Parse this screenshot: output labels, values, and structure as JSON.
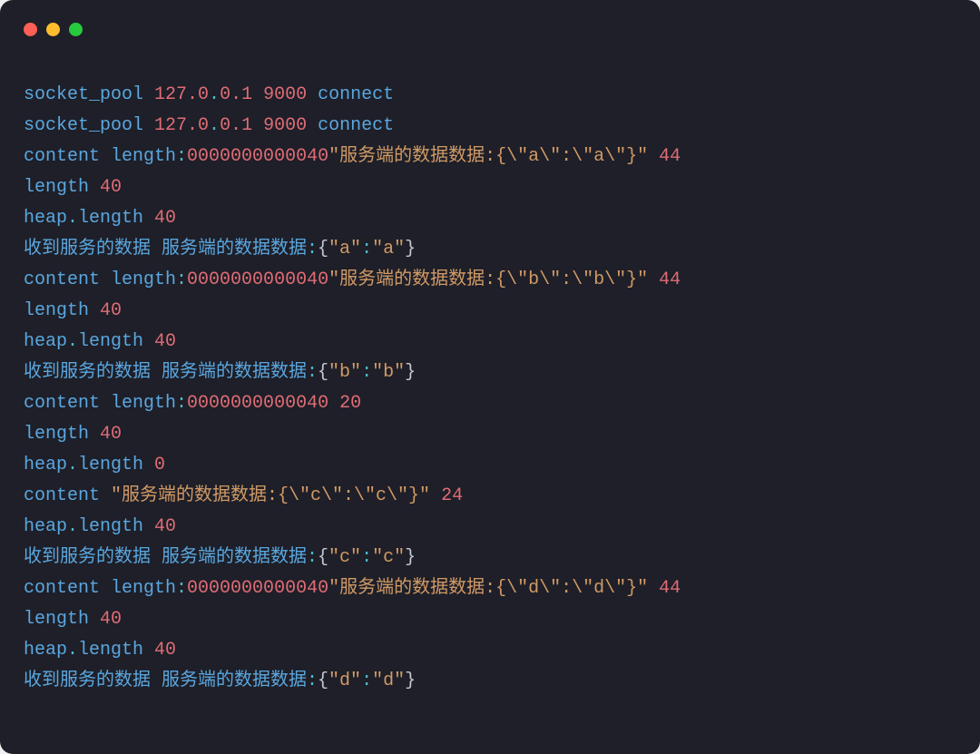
{
  "window": {
    "close_name": "close",
    "minimize_name": "minimize",
    "maximize_name": "maximize"
  },
  "lines": [
    [
      {
        "t": "socket_pool ",
        "c": "blue"
      },
      {
        "t": "127.0",
        "c": "red"
      },
      {
        "t": ".",
        "c": "cyan"
      },
      {
        "t": "0.1",
        "c": "red"
      },
      {
        "t": " ",
        "c": "default"
      },
      {
        "t": "9000",
        "c": "red"
      },
      {
        "t": " connect",
        "c": "blue"
      }
    ],
    [
      {
        "t": "socket_pool ",
        "c": "blue"
      },
      {
        "t": "127.0",
        "c": "red"
      },
      {
        "t": ".",
        "c": "cyan"
      },
      {
        "t": "0.1",
        "c": "red"
      },
      {
        "t": " ",
        "c": "default"
      },
      {
        "t": "9000",
        "c": "red"
      },
      {
        "t": " connect",
        "c": "blue"
      }
    ],
    [
      {
        "t": "content length",
        "c": "blue"
      },
      {
        "t": ":",
        "c": "cyan"
      },
      {
        "t": "0000000000040",
        "c": "red"
      },
      {
        "t": "\"服务端的数据数据:{\\\"a\\\":\\\"a\\\"}\"",
        "c": "orange"
      },
      {
        "t": " ",
        "c": "default"
      },
      {
        "t": "44",
        "c": "red"
      }
    ],
    [
      {
        "t": "length ",
        "c": "blue"
      },
      {
        "t": "40",
        "c": "red"
      }
    ],
    [
      {
        "t": "heap",
        "c": "blue"
      },
      {
        "t": ".",
        "c": "cyan"
      },
      {
        "t": "length ",
        "c": "blue"
      },
      {
        "t": "40",
        "c": "red"
      }
    ],
    [
      {
        "t": "收到服务的数据 服务端的数据数据",
        "c": "blue"
      },
      {
        "t": ":",
        "c": "cyan"
      },
      {
        "t": "{",
        "c": "default"
      },
      {
        "t": "\"a\"",
        "c": "orange"
      },
      {
        "t": ":",
        "c": "cyan"
      },
      {
        "t": "\"a\"",
        "c": "orange"
      },
      {
        "t": "}",
        "c": "default"
      }
    ],
    [
      {
        "t": "content length",
        "c": "blue"
      },
      {
        "t": ":",
        "c": "cyan"
      },
      {
        "t": "0000000000040",
        "c": "red"
      },
      {
        "t": "\"服务端的数据数据:{\\\"b\\\":\\\"b\\\"}\"",
        "c": "orange"
      },
      {
        "t": " ",
        "c": "default"
      },
      {
        "t": "44",
        "c": "red"
      }
    ],
    [
      {
        "t": "length ",
        "c": "blue"
      },
      {
        "t": "40",
        "c": "red"
      }
    ],
    [
      {
        "t": "heap",
        "c": "blue"
      },
      {
        "t": ".",
        "c": "cyan"
      },
      {
        "t": "length ",
        "c": "blue"
      },
      {
        "t": "40",
        "c": "red"
      }
    ],
    [
      {
        "t": "收到服务的数据 服务端的数据数据",
        "c": "blue"
      },
      {
        "t": ":",
        "c": "cyan"
      },
      {
        "t": "{",
        "c": "default"
      },
      {
        "t": "\"b\"",
        "c": "orange"
      },
      {
        "t": ":",
        "c": "cyan"
      },
      {
        "t": "\"b\"",
        "c": "orange"
      },
      {
        "t": "}",
        "c": "default"
      }
    ],
    [
      {
        "t": "content length",
        "c": "blue"
      },
      {
        "t": ":",
        "c": "cyan"
      },
      {
        "t": "0000000000040",
        "c": "red"
      },
      {
        "t": " ",
        "c": "default"
      },
      {
        "t": "20",
        "c": "red"
      }
    ],
    [
      {
        "t": "length ",
        "c": "blue"
      },
      {
        "t": "40",
        "c": "red"
      }
    ],
    [
      {
        "t": "heap",
        "c": "blue"
      },
      {
        "t": ".",
        "c": "cyan"
      },
      {
        "t": "length ",
        "c": "blue"
      },
      {
        "t": "0",
        "c": "red"
      }
    ],
    [
      {
        "t": "content ",
        "c": "blue"
      },
      {
        "t": "\"服务端的数据数据:{\\\"c\\\":\\\"c\\\"}\"",
        "c": "orange"
      },
      {
        "t": " ",
        "c": "default"
      },
      {
        "t": "24",
        "c": "red"
      }
    ],
    [
      {
        "t": "heap",
        "c": "blue"
      },
      {
        "t": ".",
        "c": "cyan"
      },
      {
        "t": "length ",
        "c": "blue"
      },
      {
        "t": "40",
        "c": "red"
      }
    ],
    [
      {
        "t": "收到服务的数据 服务端的数据数据",
        "c": "blue"
      },
      {
        "t": ":",
        "c": "cyan"
      },
      {
        "t": "{",
        "c": "default"
      },
      {
        "t": "\"c\"",
        "c": "orange"
      },
      {
        "t": ":",
        "c": "cyan"
      },
      {
        "t": "\"c\"",
        "c": "orange"
      },
      {
        "t": "}",
        "c": "default"
      }
    ],
    [
      {
        "t": "content length",
        "c": "blue"
      },
      {
        "t": ":",
        "c": "cyan"
      },
      {
        "t": "0000000000040",
        "c": "red"
      },
      {
        "t": "\"服务端的数据数据:{\\\"d\\\":\\\"d\\\"}\"",
        "c": "orange"
      },
      {
        "t": " ",
        "c": "default"
      },
      {
        "t": "44",
        "c": "red"
      }
    ],
    [
      {
        "t": "length ",
        "c": "blue"
      },
      {
        "t": "40",
        "c": "red"
      }
    ],
    [
      {
        "t": "heap",
        "c": "blue"
      },
      {
        "t": ".",
        "c": "cyan"
      },
      {
        "t": "length ",
        "c": "blue"
      },
      {
        "t": "40",
        "c": "red"
      }
    ],
    [
      {
        "t": "收到服务的数据 服务端的数据数据",
        "c": "blue"
      },
      {
        "t": ":",
        "c": "cyan"
      },
      {
        "t": "{",
        "c": "default"
      },
      {
        "t": "\"d\"",
        "c": "orange"
      },
      {
        "t": ":",
        "c": "cyan"
      },
      {
        "t": "\"d\"",
        "c": "orange"
      },
      {
        "t": "}",
        "c": "default"
      }
    ]
  ]
}
